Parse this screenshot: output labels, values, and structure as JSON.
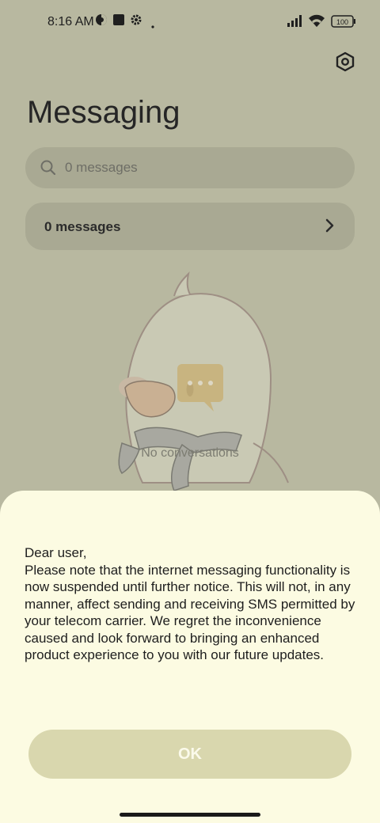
{
  "status_bar": {
    "time": "8:16 AM",
    "battery": "100",
    "icons": [
      "vpn-icon",
      "app-square-icon",
      "settings-gear-icon",
      "dot-icon",
      "signal-icon",
      "wifi-icon",
      "battery-icon"
    ]
  },
  "header": {
    "title": "Messaging",
    "settings_icon": "hexagon-settings-icon"
  },
  "search": {
    "placeholder": "0 messages",
    "icon": "search-icon"
  },
  "messages_card": {
    "label": "0 messages",
    "icon": "chevron-right-icon"
  },
  "empty_state": {
    "label": "No conversations",
    "image": "duck-illustration"
  },
  "dialog": {
    "greeting": "Dear user,",
    "body": "Please note that the internet messaging functionality is now suspended until further notice. This will not, in any manner, affect sending and receiving SMS permitted by your telecom carrier. We regret the inconvenience caused and look forward to bringing an enhanced product experience to you with our future updates.",
    "ok_label": "OK"
  },
  "colors": {
    "dim_background": "#b8b8a0",
    "sheet_background": "#fcfbe2",
    "button_background": "#d9d7ae",
    "button_text": "#fbfaeb"
  }
}
